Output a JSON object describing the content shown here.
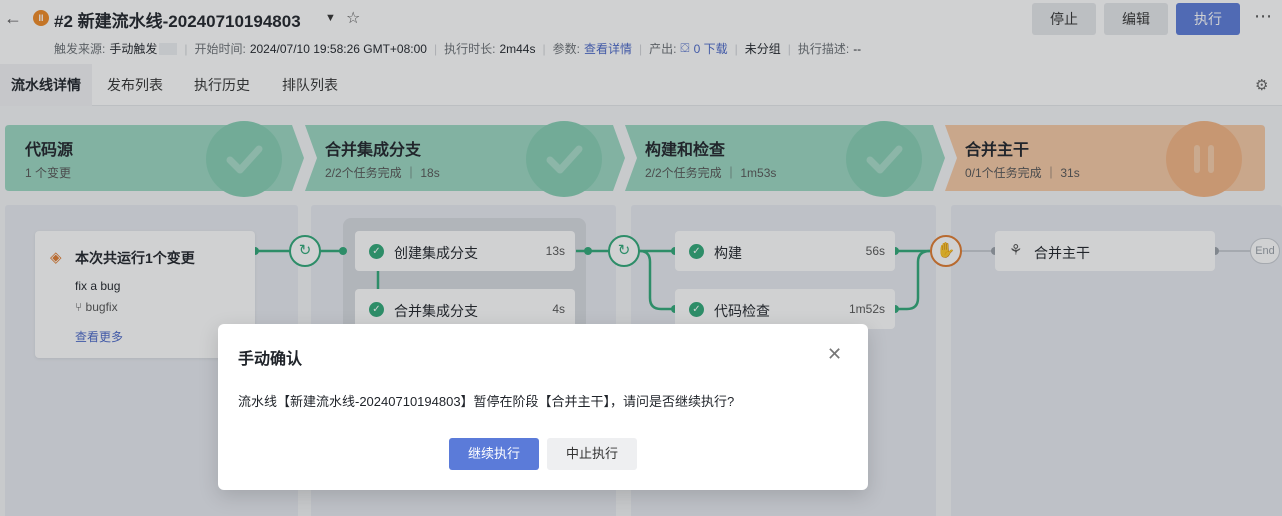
{
  "header": {
    "status_icon": "pause-icon",
    "title": "#2 新建流水线-20240710194803",
    "meta": {
      "trigger_label": "触发来源:",
      "trigger_value": "手动触发",
      "start_label": "开始时间:",
      "start_value": "2024/07/10 19:58:26 GMT+08:00",
      "duration_label": "执行时长:",
      "duration_value": "2m44s",
      "params_label": "参数:",
      "params_link": "查看详情",
      "output_label": "产出:",
      "output_link": "0 下载",
      "group_value": "未分组",
      "desc_label": "执行描述:",
      "desc_value": "--"
    },
    "buttons": {
      "stop": "停止",
      "edit": "编辑",
      "run": "执行"
    }
  },
  "tabs": [
    {
      "label": "流水线详情"
    },
    {
      "label": "发布列表"
    },
    {
      "label": "执行历史"
    },
    {
      "label": "排队列表"
    }
  ],
  "stages": [
    {
      "name": "代码源",
      "sub": "1 个变更",
      "status": "success",
      "color": "#9bd8c2"
    },
    {
      "name": "合并集成分支",
      "sub": "2/2个任务完成 ｜ 18s",
      "status": "success",
      "color": "#9bd8c2"
    },
    {
      "name": "构建和检查",
      "sub": "2/2个任务完成 ｜ 1m53s",
      "status": "success",
      "color": "#9bd8c2"
    },
    {
      "name": "合并主干",
      "sub": "0/1个任务完成 ｜ 31s",
      "status": "paused",
      "color": "#f7c9a5"
    }
  ],
  "source_card": {
    "title": "本次共运行1个变更",
    "commit_message": "fix a bug",
    "branch": "bugfix",
    "more_link": "查看更多"
  },
  "jobs": {
    "create_branch": {
      "name": "创建集成分支",
      "time": "13s"
    },
    "merge_branch": {
      "name": "合并集成分支",
      "time": "4s"
    },
    "build": {
      "name": "构建",
      "time": "56s"
    },
    "code_check": {
      "name": "代码检查",
      "time": "1m52s"
    },
    "merge_trunk": {
      "name": "合并主干"
    },
    "end_label": "End"
  },
  "modal": {
    "title": "手动确认",
    "body": "流水线【新建流水线-20240710194803】暂停在阶段【合并主干】，请问是否继续执行?",
    "continue_button": "继续执行",
    "abort_button": "中止执行"
  },
  "colors": {
    "success": "#2fa878",
    "paused": "#e07b2f",
    "primary": "#5b7bd9"
  }
}
